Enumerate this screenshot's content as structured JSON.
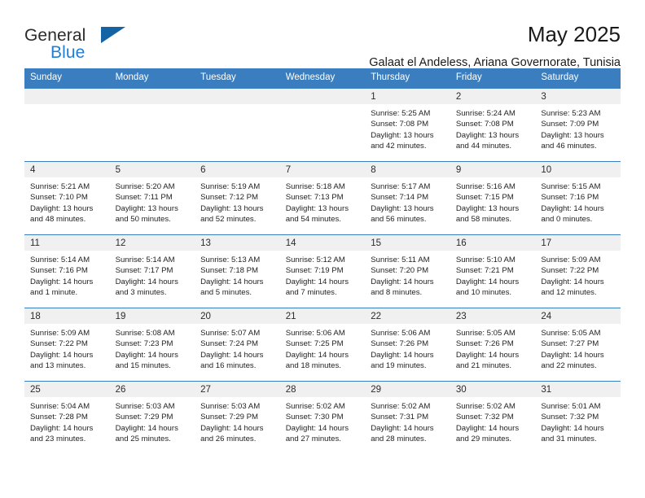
{
  "logo": {
    "general": "General",
    "blue": "Blue",
    "triangle_color": "#1464a5"
  },
  "header": {
    "month_title": "May 2025",
    "subtitle": "Galaat el Andeless, Ariana Governorate, Tunisia"
  },
  "calendar": {
    "accent_color": "#3a7ec0",
    "daynum_bg": "#f0f0f0",
    "weekday_headers": [
      "Sunday",
      "Monday",
      "Tuesday",
      "Wednesday",
      "Thursday",
      "Friday",
      "Saturday"
    ],
    "weeks": [
      [
        {
          "empty": true
        },
        {
          "empty": true
        },
        {
          "empty": true
        },
        {
          "empty": true
        },
        {
          "day": "1",
          "sunrise": "Sunrise: 5:25 AM",
          "sunset": "Sunset: 7:08 PM",
          "daylight1": "Daylight: 13 hours",
          "daylight2": "and 42 minutes."
        },
        {
          "day": "2",
          "sunrise": "Sunrise: 5:24 AM",
          "sunset": "Sunset: 7:08 PM",
          "daylight1": "Daylight: 13 hours",
          "daylight2": "and 44 minutes."
        },
        {
          "day": "3",
          "sunrise": "Sunrise: 5:23 AM",
          "sunset": "Sunset: 7:09 PM",
          "daylight1": "Daylight: 13 hours",
          "daylight2": "and 46 minutes."
        }
      ],
      [
        {
          "day": "4",
          "sunrise": "Sunrise: 5:21 AM",
          "sunset": "Sunset: 7:10 PM",
          "daylight1": "Daylight: 13 hours",
          "daylight2": "and 48 minutes."
        },
        {
          "day": "5",
          "sunrise": "Sunrise: 5:20 AM",
          "sunset": "Sunset: 7:11 PM",
          "daylight1": "Daylight: 13 hours",
          "daylight2": "and 50 minutes."
        },
        {
          "day": "6",
          "sunrise": "Sunrise: 5:19 AM",
          "sunset": "Sunset: 7:12 PM",
          "daylight1": "Daylight: 13 hours",
          "daylight2": "and 52 minutes."
        },
        {
          "day": "7",
          "sunrise": "Sunrise: 5:18 AM",
          "sunset": "Sunset: 7:13 PM",
          "daylight1": "Daylight: 13 hours",
          "daylight2": "and 54 minutes."
        },
        {
          "day": "8",
          "sunrise": "Sunrise: 5:17 AM",
          "sunset": "Sunset: 7:14 PM",
          "daylight1": "Daylight: 13 hours",
          "daylight2": "and 56 minutes."
        },
        {
          "day": "9",
          "sunrise": "Sunrise: 5:16 AM",
          "sunset": "Sunset: 7:15 PM",
          "daylight1": "Daylight: 13 hours",
          "daylight2": "and 58 minutes."
        },
        {
          "day": "10",
          "sunrise": "Sunrise: 5:15 AM",
          "sunset": "Sunset: 7:16 PM",
          "daylight1": "Daylight: 14 hours",
          "daylight2": "and 0 minutes."
        }
      ],
      [
        {
          "day": "11",
          "sunrise": "Sunrise: 5:14 AM",
          "sunset": "Sunset: 7:16 PM",
          "daylight1": "Daylight: 14 hours",
          "daylight2": "and 1 minute."
        },
        {
          "day": "12",
          "sunrise": "Sunrise: 5:14 AM",
          "sunset": "Sunset: 7:17 PM",
          "daylight1": "Daylight: 14 hours",
          "daylight2": "and 3 minutes."
        },
        {
          "day": "13",
          "sunrise": "Sunrise: 5:13 AM",
          "sunset": "Sunset: 7:18 PM",
          "daylight1": "Daylight: 14 hours",
          "daylight2": "and 5 minutes."
        },
        {
          "day": "14",
          "sunrise": "Sunrise: 5:12 AM",
          "sunset": "Sunset: 7:19 PM",
          "daylight1": "Daylight: 14 hours",
          "daylight2": "and 7 minutes."
        },
        {
          "day": "15",
          "sunrise": "Sunrise: 5:11 AM",
          "sunset": "Sunset: 7:20 PM",
          "daylight1": "Daylight: 14 hours",
          "daylight2": "and 8 minutes."
        },
        {
          "day": "16",
          "sunrise": "Sunrise: 5:10 AM",
          "sunset": "Sunset: 7:21 PM",
          "daylight1": "Daylight: 14 hours",
          "daylight2": "and 10 minutes."
        },
        {
          "day": "17",
          "sunrise": "Sunrise: 5:09 AM",
          "sunset": "Sunset: 7:22 PM",
          "daylight1": "Daylight: 14 hours",
          "daylight2": "and 12 minutes."
        }
      ],
      [
        {
          "day": "18",
          "sunrise": "Sunrise: 5:09 AM",
          "sunset": "Sunset: 7:22 PM",
          "daylight1": "Daylight: 14 hours",
          "daylight2": "and 13 minutes."
        },
        {
          "day": "19",
          "sunrise": "Sunrise: 5:08 AM",
          "sunset": "Sunset: 7:23 PM",
          "daylight1": "Daylight: 14 hours",
          "daylight2": "and 15 minutes."
        },
        {
          "day": "20",
          "sunrise": "Sunrise: 5:07 AM",
          "sunset": "Sunset: 7:24 PM",
          "daylight1": "Daylight: 14 hours",
          "daylight2": "and 16 minutes."
        },
        {
          "day": "21",
          "sunrise": "Sunrise: 5:06 AM",
          "sunset": "Sunset: 7:25 PM",
          "daylight1": "Daylight: 14 hours",
          "daylight2": "and 18 minutes."
        },
        {
          "day": "22",
          "sunrise": "Sunrise: 5:06 AM",
          "sunset": "Sunset: 7:26 PM",
          "daylight1": "Daylight: 14 hours",
          "daylight2": "and 19 minutes."
        },
        {
          "day": "23",
          "sunrise": "Sunrise: 5:05 AM",
          "sunset": "Sunset: 7:26 PM",
          "daylight1": "Daylight: 14 hours",
          "daylight2": "and 21 minutes."
        },
        {
          "day": "24",
          "sunrise": "Sunrise: 5:05 AM",
          "sunset": "Sunset: 7:27 PM",
          "daylight1": "Daylight: 14 hours",
          "daylight2": "and 22 minutes."
        }
      ],
      [
        {
          "day": "25",
          "sunrise": "Sunrise: 5:04 AM",
          "sunset": "Sunset: 7:28 PM",
          "daylight1": "Daylight: 14 hours",
          "daylight2": "and 23 minutes."
        },
        {
          "day": "26",
          "sunrise": "Sunrise: 5:03 AM",
          "sunset": "Sunset: 7:29 PM",
          "daylight1": "Daylight: 14 hours",
          "daylight2": "and 25 minutes."
        },
        {
          "day": "27",
          "sunrise": "Sunrise: 5:03 AM",
          "sunset": "Sunset: 7:29 PM",
          "daylight1": "Daylight: 14 hours",
          "daylight2": "and 26 minutes."
        },
        {
          "day": "28",
          "sunrise": "Sunrise: 5:02 AM",
          "sunset": "Sunset: 7:30 PM",
          "daylight1": "Daylight: 14 hours",
          "daylight2": "and 27 minutes."
        },
        {
          "day": "29",
          "sunrise": "Sunrise: 5:02 AM",
          "sunset": "Sunset: 7:31 PM",
          "daylight1": "Daylight: 14 hours",
          "daylight2": "and 28 minutes."
        },
        {
          "day": "30",
          "sunrise": "Sunrise: 5:02 AM",
          "sunset": "Sunset: 7:32 PM",
          "daylight1": "Daylight: 14 hours",
          "daylight2": "and 29 minutes."
        },
        {
          "day": "31",
          "sunrise": "Sunrise: 5:01 AM",
          "sunset": "Sunset: 7:32 PM",
          "daylight1": "Daylight: 14 hours",
          "daylight2": "and 31 minutes."
        }
      ]
    ]
  }
}
